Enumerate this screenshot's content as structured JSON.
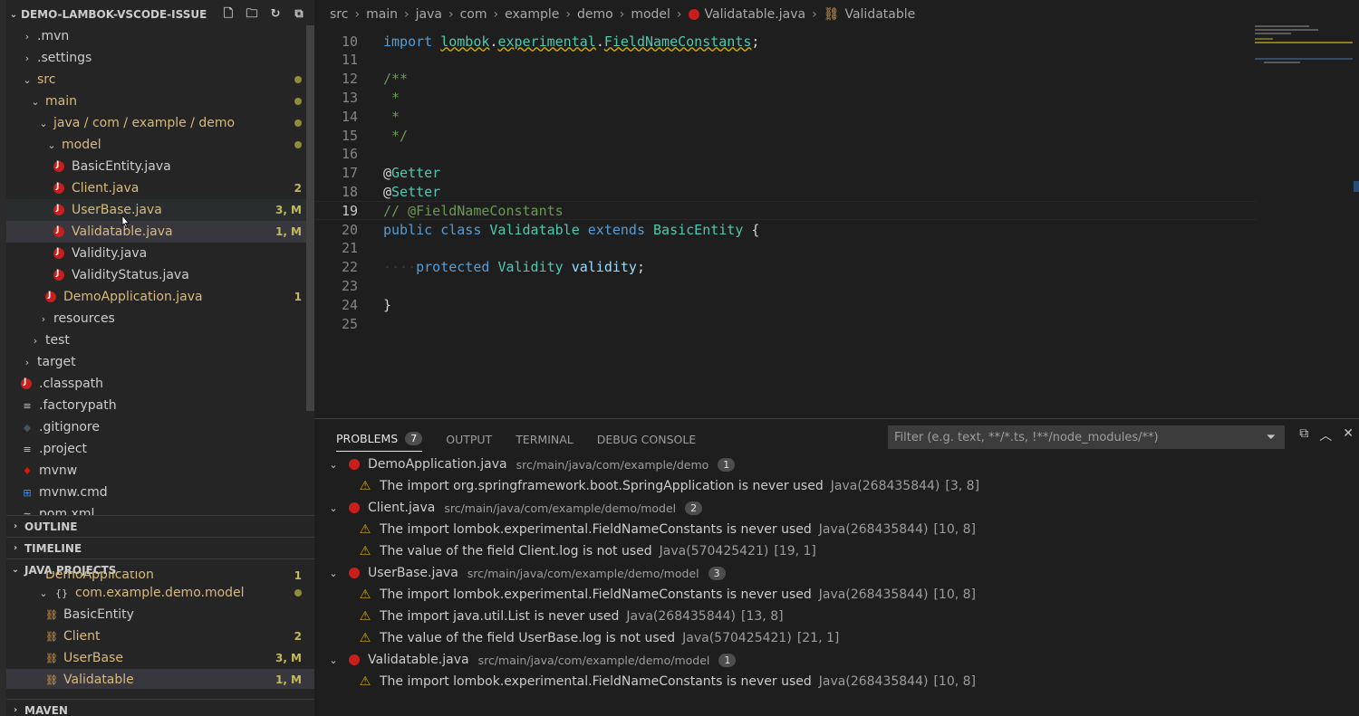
{
  "sidebar": {
    "title": "DEMO-LAMBOK-VSCODE-ISSUE",
    "tree": [
      {
        "label": ".mvn",
        "indent": 0,
        "chev": "›"
      },
      {
        "label": ".settings",
        "indent": 0,
        "chev": "›"
      },
      {
        "label": "src",
        "indent": 0,
        "chev": "⌄",
        "dot": true
      },
      {
        "label": "main",
        "indent": 1,
        "chev": "⌄",
        "dot": true
      },
      {
        "label": "java / com / example / demo",
        "indent": 2,
        "chev": "⌄",
        "dot": true
      },
      {
        "label": "model",
        "indent": 3,
        "chev": "⌄",
        "dot": true
      },
      {
        "label": "BasicEntity.java",
        "indent": 4,
        "java": true
      },
      {
        "label": "Client.java",
        "indent": 4,
        "java": true,
        "badge": "2"
      },
      {
        "label": "UserBase.java",
        "indent": 4,
        "java": true,
        "badge": "3, M"
      },
      {
        "label": "Validatable.java",
        "indent": 4,
        "java": true,
        "badge": "1, M"
      },
      {
        "label": "Validity.java",
        "indent": 4,
        "java": true
      },
      {
        "label": "ValidityStatus.java",
        "indent": 4,
        "java": true
      },
      {
        "label": "DemoApplication.java",
        "indent": 3,
        "java": true,
        "badge": "1"
      },
      {
        "label": "resources",
        "indent": 2,
        "chev": "›"
      },
      {
        "label": "test",
        "indent": 1,
        "chev": "›"
      },
      {
        "label": "target",
        "indent": 0,
        "chev": "›"
      },
      {
        "label": ".classpath",
        "indent": 0,
        "java": true
      },
      {
        "label": ".factorypath",
        "indent": 0,
        "file": "≡"
      },
      {
        "label": ".gitignore",
        "indent": 0,
        "file": "◆"
      },
      {
        "label": ".project",
        "indent": 0,
        "file": "≡"
      },
      {
        "label": "mvnw",
        "indent": 0,
        "file": "♦"
      },
      {
        "label": "mvnw.cmd",
        "indent": 0,
        "file": "⊞"
      },
      {
        "label": "pom.xml",
        "indent": 0,
        "file": "≈"
      }
    ],
    "sections": {
      "outline": "OUTLINE",
      "timeline": "TIMELINE",
      "java_projects": "JAVA PROJECTS",
      "maven": "MAVEN"
    },
    "java_projects": [
      {
        "label": "DemoApplication",
        "indent": 3,
        "badge": "1"
      },
      {
        "label": "com.example.demo.model",
        "indent": 2,
        "chev": "⌄",
        "pkg": true,
        "dot": true
      },
      {
        "label": "BasicEntity",
        "indent": 3,
        "cls": true
      },
      {
        "label": "Client",
        "indent": 3,
        "cls": true,
        "badge": "2"
      },
      {
        "label": "UserBase",
        "indent": 3,
        "cls": true,
        "badge": "3, M"
      },
      {
        "label": "Validatable",
        "indent": 3,
        "cls": true,
        "badge": "1, M"
      }
    ]
  },
  "breadcrumb": [
    "src",
    "main",
    "java",
    "com",
    "example",
    "demo",
    "model",
    "Validatable.java",
    "Validatable"
  ],
  "code": [
    {
      "n": "10",
      "tokens": [
        [
          "kw",
          "import "
        ],
        [
          "pk",
          "lombok"
        ],
        [
          "pl",
          "."
        ],
        [
          "pk",
          "experimental"
        ],
        [
          "pl",
          "."
        ],
        [
          "pk",
          "FieldNameConstants"
        ],
        [
          "pl",
          ";"
        ]
      ]
    },
    {
      "n": "11",
      "tokens": []
    },
    {
      "n": "12",
      "tokens": [
        [
          "cm",
          "/**"
        ]
      ]
    },
    {
      "n": "13",
      "tokens": [
        [
          "cm",
          " *"
        ]
      ]
    },
    {
      "n": "14",
      "tokens": [
        [
          "cm",
          " *"
        ]
      ]
    },
    {
      "n": "15",
      "tokens": [
        [
          "cm",
          " */"
        ]
      ]
    },
    {
      "n": "16",
      "tokens": []
    },
    {
      "n": "17",
      "tokens": [
        [
          "pl",
          "@"
        ],
        [
          "ty",
          "Getter"
        ]
      ]
    },
    {
      "n": "18",
      "tokens": [
        [
          "pl",
          "@"
        ],
        [
          "ty",
          "Setter"
        ]
      ]
    },
    {
      "n": "19",
      "tokens": [
        [
          "cm",
          "// @FieldNameConstants"
        ]
      ]
    },
    {
      "n": "20",
      "tokens": [
        [
          "kw",
          "public "
        ],
        [
          "kw",
          "class "
        ],
        [
          "ty",
          "Validatable "
        ],
        [
          "kw",
          "extends "
        ],
        [
          "ty",
          "BasicEntity "
        ],
        [
          "pl",
          "{"
        ]
      ]
    },
    {
      "n": "21",
      "tokens": []
    },
    {
      "n": "22",
      "tokens": [
        [
          "ws",
          "····"
        ],
        [
          "kw",
          "protected "
        ],
        [
          "ty",
          "Validity "
        ],
        [
          "id",
          "validity"
        ],
        [
          "pl",
          ";"
        ]
      ]
    },
    {
      "n": "23",
      "tokens": []
    },
    {
      "n": "24",
      "tokens": [
        [
          "pl",
          "}"
        ]
      ]
    },
    {
      "n": "25",
      "tokens": []
    }
  ],
  "panel": {
    "tabs": [
      "PROBLEMS",
      "OUTPUT",
      "TERMINAL",
      "DEBUG CONSOLE"
    ],
    "problems_count": "7",
    "filter_placeholder": "Filter (e.g. text, **/*.ts, !**/node_modules/**)",
    "groups": [
      {
        "file": "DemoApplication.java",
        "path": "src/main/java/com/example/demo",
        "count": "1",
        "items": [
          {
            "msg": "The import org.springframework.boot.SpringApplication is never used",
            "src": "Java(268435844)",
            "pos": "[3, 8]"
          }
        ]
      },
      {
        "file": "Client.java",
        "path": "src/main/java/com/example/demo/model",
        "count": "2",
        "items": [
          {
            "msg": "The import lombok.experimental.FieldNameConstants is never used",
            "src": "Java(268435844)",
            "pos": "[10, 8]"
          },
          {
            "msg": "The value of the field Client.log is not used",
            "src": "Java(570425421)",
            "pos": "[19, 1]"
          }
        ]
      },
      {
        "file": "UserBase.java",
        "path": "src/main/java/com/example/demo/model",
        "count": "3",
        "items": [
          {
            "msg": "The import lombok.experimental.FieldNameConstants is never used",
            "src": "Java(268435844)",
            "pos": "[10, 8]"
          },
          {
            "msg": "The import java.util.List is never used",
            "src": "Java(268435844)",
            "pos": "[13, 8]"
          },
          {
            "msg": "The value of the field UserBase.log is not used",
            "src": "Java(570425421)",
            "pos": "[21, 1]"
          }
        ]
      },
      {
        "file": "Validatable.java",
        "path": "src/main/java/com/example/demo/model",
        "count": "1",
        "items": [
          {
            "msg": "The import lombok.experimental.FieldNameConstants is never used",
            "src": "Java(268435844)",
            "pos": "[10, 8]"
          }
        ]
      }
    ]
  }
}
